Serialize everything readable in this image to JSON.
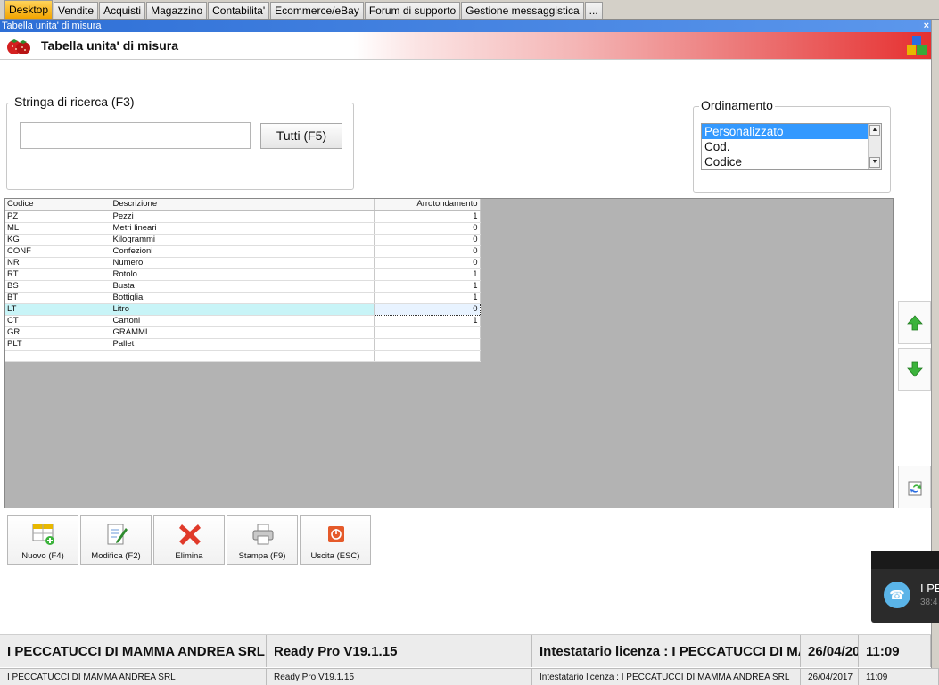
{
  "tabs": [
    {
      "label": "Desktop",
      "active": true
    },
    {
      "label": "Vendite"
    },
    {
      "label": "Acquisti"
    },
    {
      "label": "Magazzino"
    },
    {
      "label": "Contabilita'"
    },
    {
      "label": "Ecommerce/eBay"
    },
    {
      "label": "Forum di supporto"
    },
    {
      "label": "Gestione messaggistica"
    },
    {
      "label": "..."
    }
  ],
  "window": {
    "title": "Tabella unita' di misura",
    "close_glyph": "×",
    "header_title": "Tabella unita' di misura"
  },
  "search": {
    "legend": "Stringa di ricerca (F3)",
    "value": "",
    "tutti_label": "Tutti (F5)"
  },
  "ordering": {
    "legend": "Ordinamento",
    "options": [
      "Personalizzato",
      "Cod.",
      "Codice"
    ],
    "selected": "Personalizzato"
  },
  "grid": {
    "columns": [
      "Codice",
      "Descrizione",
      "Arrotondamento"
    ],
    "rows": [
      [
        "PZ",
        "Pezzi",
        "1"
      ],
      [
        "ML",
        "Metri lineari",
        "0"
      ],
      [
        "KG",
        "Kilogrammi",
        "0"
      ],
      [
        "CONF",
        "Confezioni",
        "0"
      ],
      [
        "NR",
        "Numero",
        "0"
      ],
      [
        "RT",
        "Rotolo",
        "1"
      ],
      [
        "BS",
        "Busta",
        "1"
      ],
      [
        "BT",
        "Bottiglia",
        "1"
      ],
      [
        "LT",
        "Litro",
        "0"
      ],
      [
        "CT",
        "Cartoni",
        "1"
      ],
      [
        "GR",
        "GRAMMI",
        ""
      ],
      [
        "PLT",
        "Pallet",
        ""
      ],
      [
        "",
        "",
        ""
      ]
    ],
    "selected_row": 8
  },
  "toolbar": {
    "nuovo": "Nuovo (F4)",
    "modifica": "Modifica (F2)",
    "elimina": "Elimina",
    "stampa": "Stampa (F9)",
    "uscita": "Uscita (ESC)"
  },
  "side_buttons": {
    "up_icon": "arrow-up-icon",
    "down_icon": "arrow-down-icon",
    "refresh_icon": "refresh-icon"
  },
  "toast": {
    "title": "I PE",
    "subtitle": "38:4"
  },
  "status": {
    "company": "I PECCATUCCI DI MAMMA ANDREA SRL",
    "version": "Ready Pro V19.1.15",
    "license": "Intestatario licenza : I PECCATUCCI DI MAMMA ANDREA SRL",
    "date": "26/04/2017",
    "time": "11:09"
  },
  "colors": {
    "tab_active": "#f2a400",
    "selection": "#3399ff",
    "grid_selected_row": "#c8f4f7",
    "header_gradient_end": "#e63030",
    "arrow_green": "#3cb33c",
    "delete_red": "#e03a2a"
  }
}
